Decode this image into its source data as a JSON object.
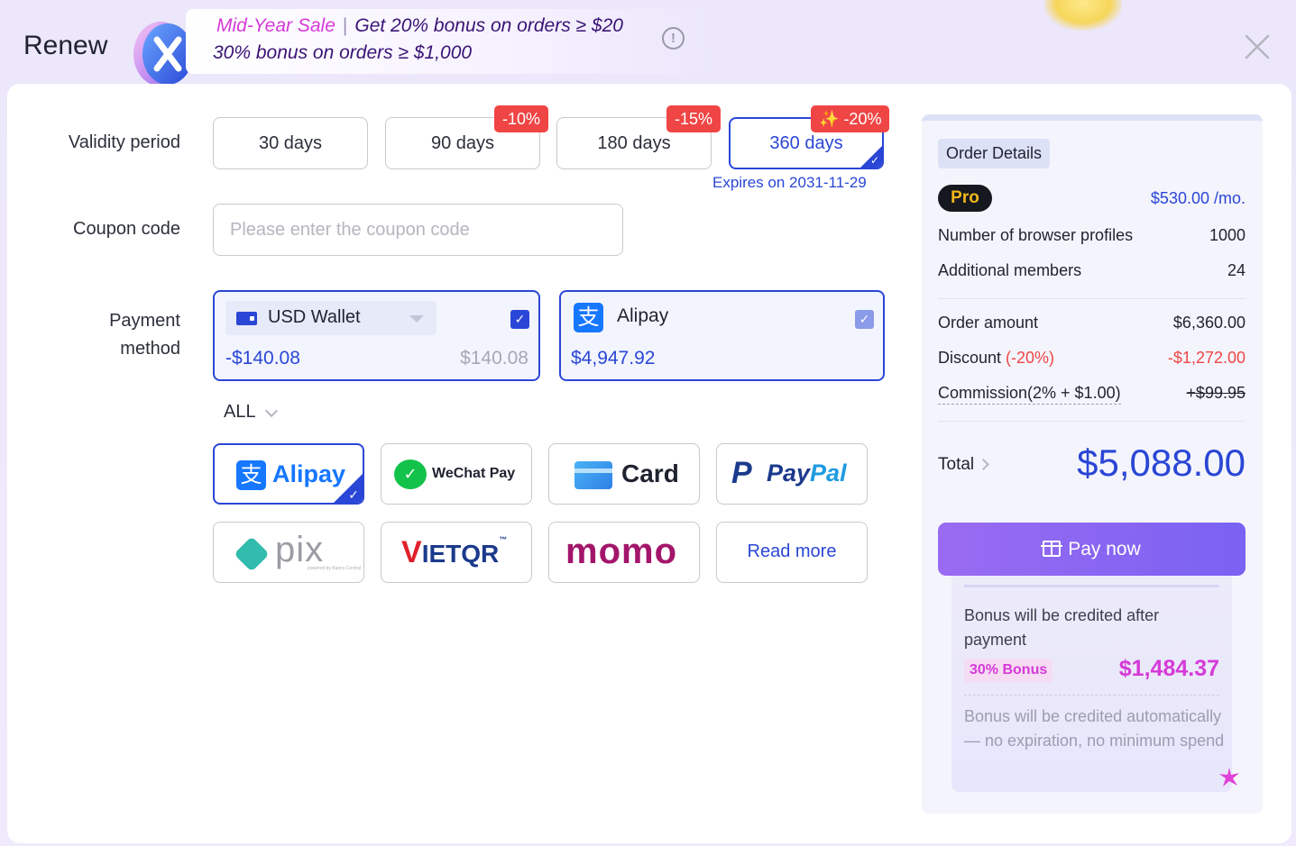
{
  "header": {
    "title": "Renew",
    "promo_sale": "Mid-Year Sale",
    "promo_sep": "|",
    "promo_line1": "Get 20% bonus on orders ≥ $20",
    "promo_line2": "30% bonus on orders ≥ $1,000",
    "info_icon": "!"
  },
  "form": {
    "validity_label": "Validity period",
    "coupon_label": "Coupon code",
    "payment_label_1": "Payment",
    "payment_label_2": "method",
    "periods": [
      {
        "label": "30 days",
        "discount": ""
      },
      {
        "label": "90 days",
        "discount": "-10%"
      },
      {
        "label": "180 days",
        "discount": "-15%"
      },
      {
        "label": "360 days",
        "discount": "-20%",
        "selected": true
      }
    ],
    "badge_sparkle": "✨",
    "expires": "Expires on 2031-11-29",
    "coupon_placeholder": "Please enter the coupon code",
    "wallet": {
      "label": "USD Wallet",
      "amount_used": "-$140.08",
      "balance": "$140.08",
      "check": "✓"
    },
    "alipay_card": {
      "icon_glyph": "支",
      "label": "Alipay",
      "amount": "$4,947.92",
      "check": "✓"
    },
    "filter_label": "ALL",
    "methods": {
      "alipay": "Alipay",
      "alipay_glyph": "支",
      "wechat": "WeChat Pay",
      "wechat_glyph": "✓",
      "card": "Card",
      "paypal_p": "P",
      "paypal_1": "Pay",
      "paypal_2": "Pal",
      "pix": "pix",
      "pix_sub": "powered by Banco Central",
      "vietqr_v": "V",
      "vietqr_rest": "IETQR",
      "vietqr_tm": "™",
      "momo": "momo",
      "read_more": "Read more"
    }
  },
  "order": {
    "title": "Order Details",
    "plan": "Pro",
    "price_per_month": "$530.00 /mo.",
    "profiles_label": "Number of browser profiles",
    "profiles_value": "1000",
    "members_label": "Additional members",
    "members_value": "24",
    "order_amount_label": "Order amount",
    "order_amount_value": "$6,360.00",
    "discount_label": "Discount",
    "discount_pct": "(-20%)",
    "discount_value": "-$1,272.00",
    "commission_label": "Commission(2% + $1.00)",
    "commission_value": "+$99.95",
    "total_label": "Total",
    "total_value": "$5,088.00",
    "pay_now": "Pay now",
    "bonus_text": "Bonus will be credited after payment",
    "bonus_pill": "30% Bonus",
    "bonus_amount": "$1,484.37",
    "bonus_note": "Bonus will be credited automatically — no expiration, no minimum spend"
  },
  "colors": {
    "accent": "#2a46d6",
    "danger": "#f04545",
    "bonus": "#d53ad8",
    "pay_button": "#8b66f2"
  },
  "icons": [
    "info-icon",
    "close-icon",
    "wallet-icon",
    "alipay-icon",
    "wechat-icon",
    "card-icon",
    "paypal-icon",
    "pix-icon",
    "gift-icon",
    "sparkle-icon"
  ]
}
